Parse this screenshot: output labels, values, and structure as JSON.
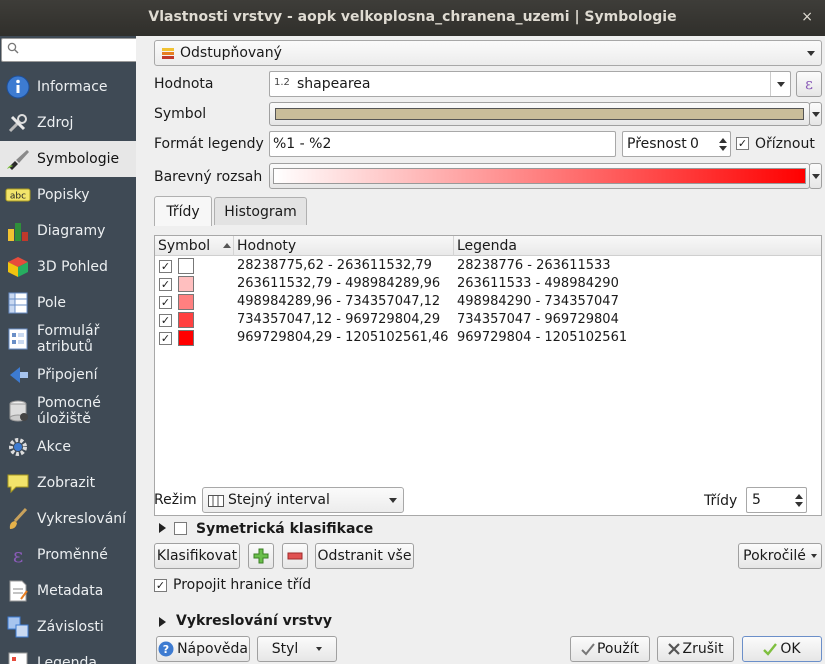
{
  "window": {
    "title": "Vlastnosti vrstvy - aopk velkoplosna_chranena_uzemi | Symbologie",
    "close_glyph": "×"
  },
  "search": {
    "placeholder": ""
  },
  "sidebar": {
    "items": [
      {
        "label": "Informace",
        "icon": "info-icon"
      },
      {
        "label": "Zdroj",
        "icon": "source-tools-icon"
      },
      {
        "label": "Symbologie",
        "icon": "paintbrush-icon",
        "active": true
      },
      {
        "label": "Popisky",
        "icon": "abc-label-icon"
      },
      {
        "label": "Diagramy",
        "icon": "diagram-icon"
      },
      {
        "label": "3D Pohled",
        "icon": "cube-3d-icon"
      },
      {
        "label": "Pole",
        "icon": "fields-icon"
      },
      {
        "label": "Formulář atributů",
        "icon": "form-icon"
      },
      {
        "label": "Připojení",
        "icon": "join-icon"
      },
      {
        "label": "Pomocné úložiště",
        "icon": "storage-icon"
      },
      {
        "label": "Akce",
        "icon": "gear-action-icon"
      },
      {
        "label": "Zobrazit",
        "icon": "speech-bubble-icon"
      },
      {
        "label": "Vykreslování",
        "icon": "brush-icon"
      },
      {
        "label": "Proměnné",
        "icon": "epsilon-icon"
      },
      {
        "label": "Metadata",
        "icon": "metadata-icon"
      },
      {
        "label": "Závislosti",
        "icon": "dependencies-icon"
      },
      {
        "label": "Legenda",
        "icon": "legend-icon"
      }
    ]
  },
  "renderer": {
    "selected": "Odstupňovaný"
  },
  "value": {
    "label": "Hodnota",
    "type_prefix": "1.2",
    "field": "shapearea",
    "expr_glyph": "ε"
  },
  "symbol": {
    "label": "Symbol",
    "color": "#c9bd9a"
  },
  "legend_format": {
    "label": "Formát legendy",
    "value": "%1 - %2",
    "precision_label": "Přesnost",
    "precision_value": "0",
    "trim_label": "Oříznout",
    "trim_checked": true
  },
  "color_ramp": {
    "label": "Barevný rozsah",
    "start": "#ffffff",
    "end": "#ff0000"
  },
  "tabs": [
    {
      "label": "Třídy"
    },
    {
      "label": "Histogram"
    }
  ],
  "table": {
    "headers": [
      "Symbol",
      "Hodnoty",
      "Legenda"
    ],
    "rows": [
      {
        "checked": "✓",
        "color": "#ffffff",
        "values": "28238775,62 - 263611532,79",
        "legend": "28238776 - 263611533"
      },
      {
        "checked": "✓",
        "color": "#ffbfbf",
        "values": "263611532,79 - 498984289,96",
        "legend": "263611533 - 498984290"
      },
      {
        "checked": "✓",
        "color": "#ff8080",
        "values": "498984289,96 - 734357047,12",
        "legend": "498984290 - 734357047"
      },
      {
        "checked": "✓",
        "color": "#ff4040",
        "values": "734357047,12 - 969729804,29",
        "legend": "734357047 - 969729804"
      },
      {
        "checked": "✓",
        "color": "#ff0000",
        "values": "969729804,29 - 1205102561,46",
        "legend": "969729804 - 1205102561"
      }
    ]
  },
  "mode": {
    "label": "Režim",
    "value": "Stejný interval"
  },
  "classes": {
    "label": "Třídy",
    "value": "5"
  },
  "symmetric": {
    "label": "Symetrická klasifikace"
  },
  "buttons": {
    "classify": "Klasifikovat",
    "add": "+",
    "remove": "−",
    "delete_all": "Odstranit vše",
    "advanced": "Pokročilé",
    "help": "Nápověda",
    "style": "Styl",
    "apply": "Použít",
    "cancel": "Zrušit",
    "ok": "OK"
  },
  "link_bounds": {
    "label": "Propojit hranice tříd",
    "checked": true
  },
  "layer_rendering": {
    "label": "Vykreslování vrstvy"
  }
}
